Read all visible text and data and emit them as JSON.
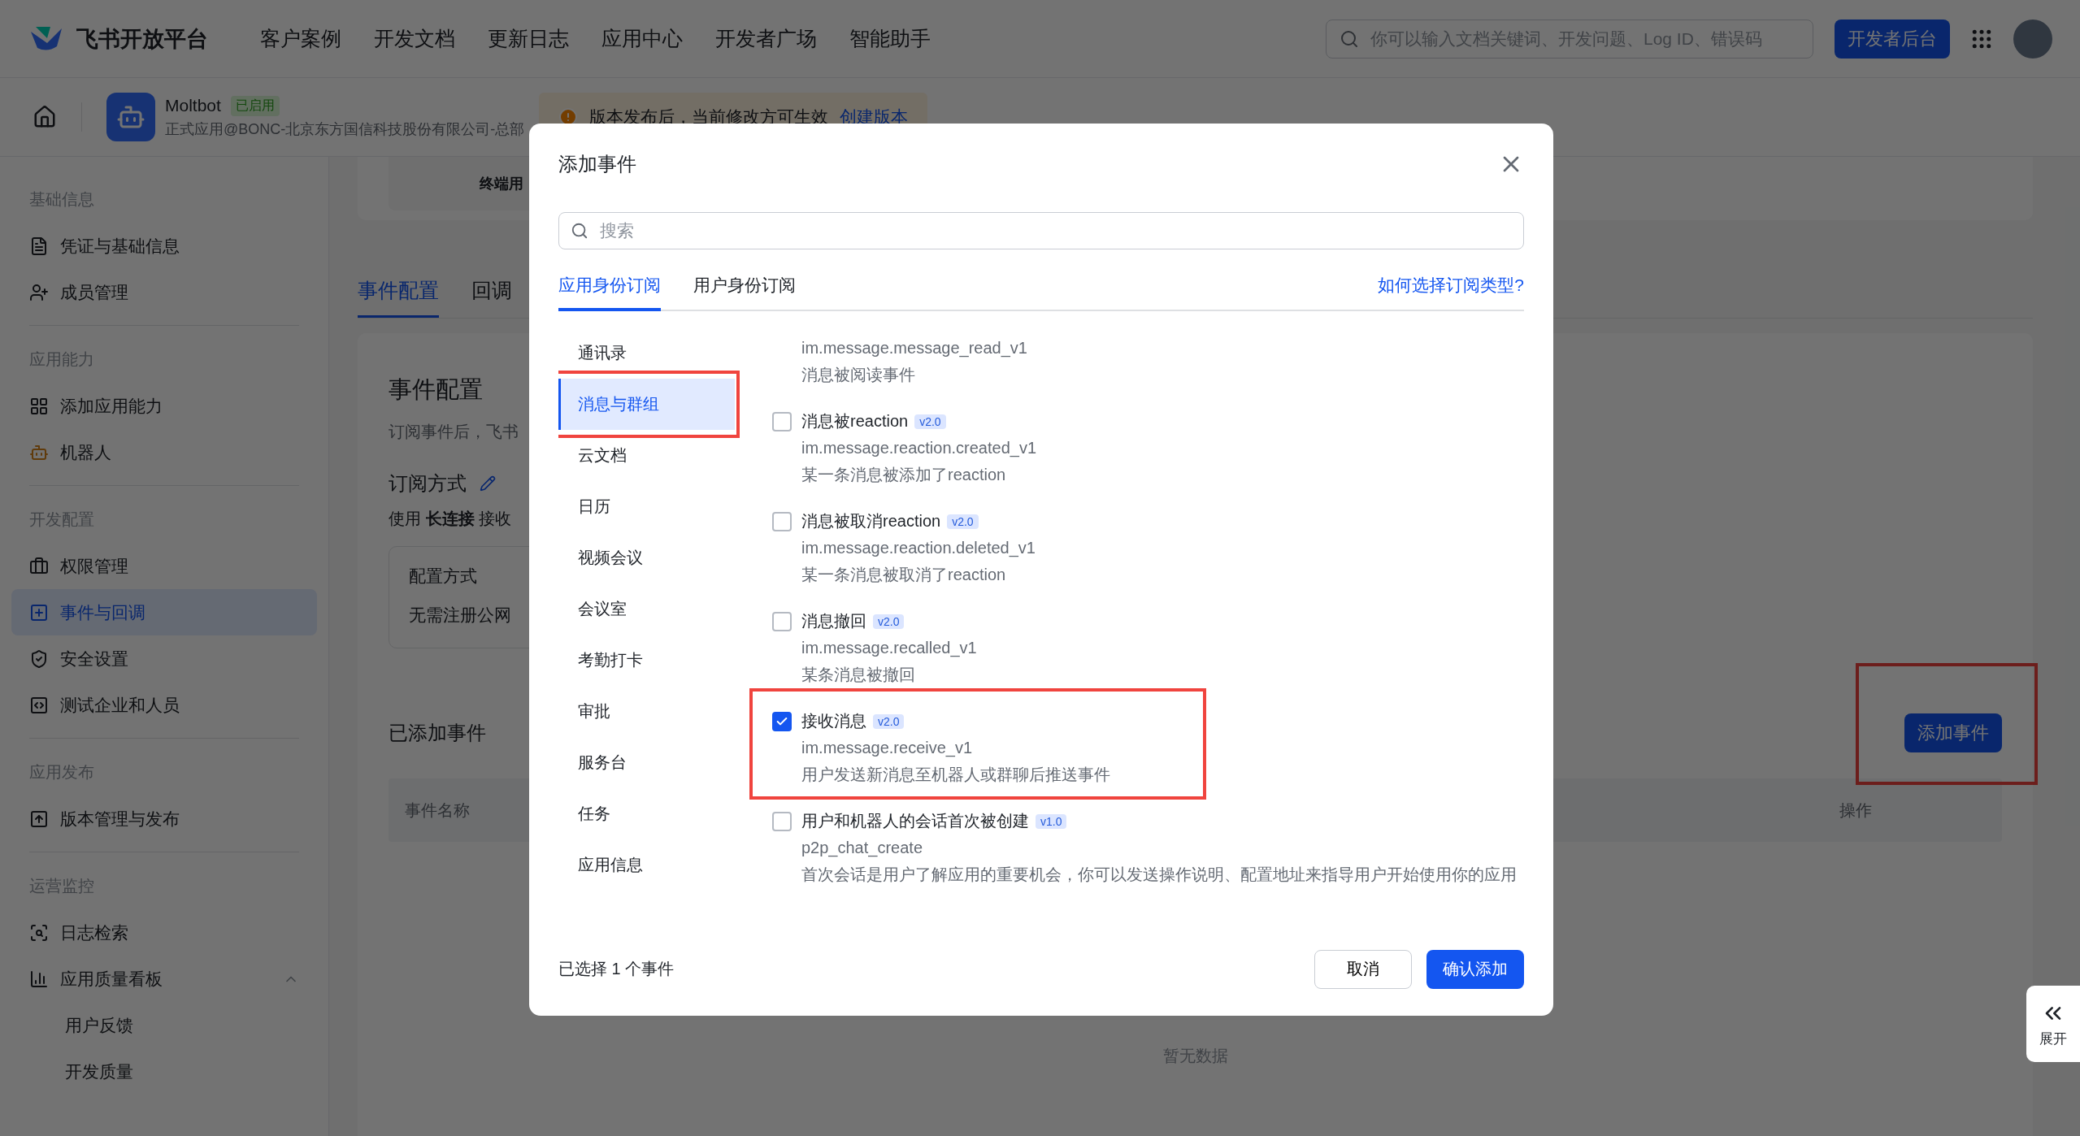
{
  "top_nav": {
    "logo": "飞书开放平台",
    "links": [
      "客户案例",
      "开发文档",
      "更新日志",
      "应用中心",
      "开发者广场",
      "智能助手"
    ],
    "search": {
      "placeholder": "你可以输入文档关键词、开发问题、Log ID、错误码"
    },
    "console_button": "开发者后台"
  },
  "app_header": {
    "name": "Moltbot",
    "status": "已启用",
    "subtitle": "正式应用@BONC-北京东方国信科技股份有限公司-总部",
    "notice": {
      "text": "版本发布后，当前修改方可生效",
      "link": "创建版本"
    }
  },
  "sidebar": {
    "sections": [
      {
        "title": "基础信息",
        "items": [
          {
            "label": "凭证与基础信息",
            "selected": false
          },
          {
            "label": "成员管理",
            "selected": false
          }
        ]
      },
      {
        "title": "应用能力",
        "items": [
          {
            "label": "添加应用能力",
            "selected": false
          },
          {
            "label": "机器人",
            "selected": false
          }
        ]
      },
      {
        "title": "开发配置",
        "items": [
          {
            "label": "权限管理",
            "selected": false
          },
          {
            "label": "事件与回调",
            "selected": true
          },
          {
            "label": "安全设置",
            "selected": false
          },
          {
            "label": "测试企业和人员",
            "selected": false
          }
        ]
      },
      {
        "title": "应用发布",
        "items": [
          {
            "label": "版本管理与发布",
            "selected": false
          }
        ]
      },
      {
        "title": "运营监控",
        "items": [
          {
            "label": "日志检索",
            "selected": false
          },
          {
            "label": "应用质量看板",
            "selected": false,
            "expanded": true,
            "children": [
              {
                "label": "用户反馈",
                "selected": false
              },
              {
                "label": "开发质量",
                "selected": false
              }
            ]
          }
        ]
      }
    ]
  },
  "main": {
    "card_text": "终端用",
    "tabs": [
      {
        "label": "事件配置",
        "selected": true
      },
      {
        "label": "回调",
        "selected": false
      }
    ],
    "section_title": "事件配置",
    "section_desc": "订阅事件后，飞书",
    "subscribe_label": "订阅方式",
    "subscribe_text": "使用 **长连接** 接收",
    "config_label": "配置方式",
    "config_value": "无需注册公网",
    "added_title": "已添加事件",
    "add_button": {
      "label": "添加事件",
      "annotated": true
    },
    "columns": [
      "事件名称",
      "操作"
    ],
    "empty": "暂无数据"
  },
  "dialog": {
    "title": "添加事件",
    "search": {
      "placeholder": "搜索"
    },
    "tabs": [
      {
        "label": "应用身份订阅",
        "selected": true
      },
      {
        "label": "用户身份订阅",
        "selected": false
      }
    ],
    "help_link": "如何选择订阅类型?",
    "categories": [
      {
        "label": "通讯录",
        "selected": false,
        "annotated": false
      },
      {
        "label": "消息与群组",
        "selected": true,
        "annotated": true
      },
      {
        "label": "云文档",
        "selected": false,
        "annotated": false
      },
      {
        "label": "日历",
        "selected": false,
        "annotated": false
      },
      {
        "label": "视频会议",
        "selected": false,
        "annotated": false
      },
      {
        "label": "会议室",
        "selected": false,
        "annotated": false
      },
      {
        "label": "考勤打卡",
        "selected": false,
        "annotated": false
      },
      {
        "label": "审批",
        "selected": false,
        "annotated": false
      },
      {
        "label": "服务台",
        "selected": false,
        "annotated": false
      },
      {
        "label": "任务",
        "selected": false,
        "annotated": false
      },
      {
        "label": "应用信息",
        "selected": false,
        "annotated": false
      }
    ],
    "events": [
      {
        "code": "im.message.message_read_v1",
        "description": "消息被阅读事件"
      },
      {
        "title": "消息被reaction",
        "version": "v2.0",
        "code": "im.message.reaction.created_v1",
        "description": "某一条消息被添加了reaction",
        "checked": false,
        "annotated": false
      },
      {
        "title": "消息被取消reaction",
        "version": "v2.0",
        "code": "im.message.reaction.deleted_v1",
        "description": "某一条消息被取消了reaction",
        "checked": false,
        "annotated": false
      },
      {
        "title": "消息撤回",
        "version": "v2.0",
        "code": "im.message.recalled_v1",
        "description": "某条消息被撤回",
        "checked": false,
        "annotated": false
      },
      {
        "title": "接收消息",
        "version": "v2.0",
        "code": "im.message.receive_v1",
        "description": "用户发送新消息至机器人或群聊后推送事件",
        "checked": true,
        "annotated": true
      },
      {
        "title": "用户和机器人的会话首次被创建",
        "version": "v1.0",
        "code": "p2p_chat_create",
        "description": "首次会话是用户了解应用的重要机会，你可以发送操作说明、配置地址来指导用户开始使用你的应用",
        "checked": false,
        "annotated": false
      }
    ],
    "selection_count": "已选择 1 个事件",
    "cancel_button": "取消",
    "confirm_button": "确认添加"
  },
  "expand_tab": {
    "label": "展开"
  }
}
